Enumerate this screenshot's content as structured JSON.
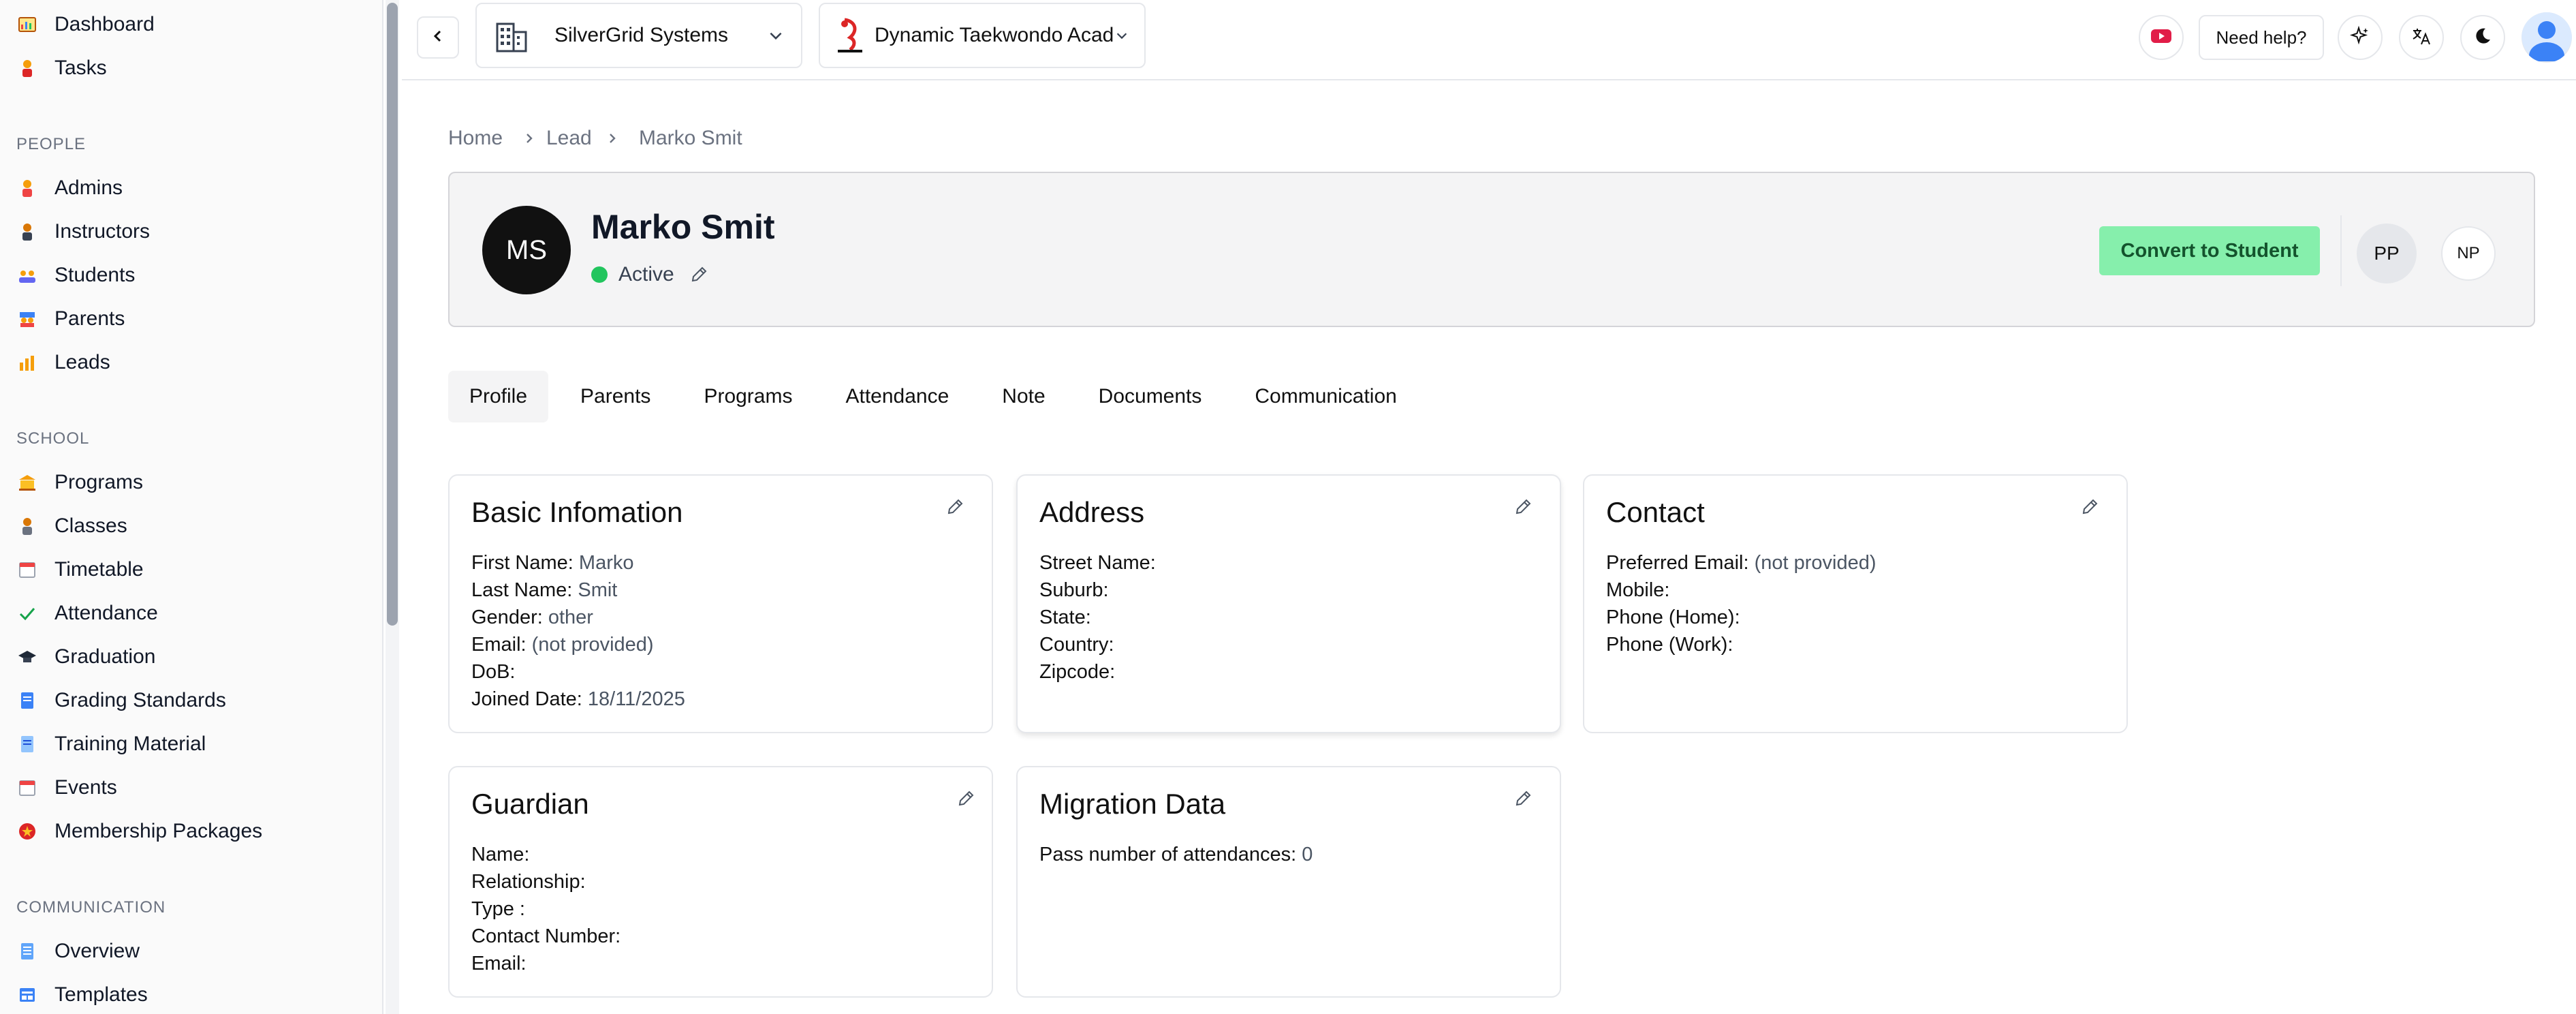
{
  "sidebar": {
    "top_items": [
      {
        "label": "Dashboard",
        "icon": "dashboard-icon"
      },
      {
        "label": "Tasks",
        "icon": "tasks-icon"
      }
    ],
    "sections": [
      {
        "label": "PEOPLE",
        "items": [
          {
            "label": "Admins",
            "icon": "admin-icon"
          },
          {
            "label": "Instructors",
            "icon": "instructor-icon"
          },
          {
            "label": "Students",
            "icon": "students-icon"
          },
          {
            "label": "Parents",
            "icon": "parents-icon"
          },
          {
            "label": "Leads",
            "icon": "leads-icon"
          }
        ]
      },
      {
        "label": "SCHOOL",
        "items": [
          {
            "label": "Programs",
            "icon": "programs-icon"
          },
          {
            "label": "Classes",
            "icon": "classes-icon"
          },
          {
            "label": "Timetable",
            "icon": "calendar-icon"
          },
          {
            "label": "Attendance",
            "icon": "check-icon"
          },
          {
            "label": "Graduation",
            "icon": "graduation-cap-icon"
          },
          {
            "label": "Grading Standards",
            "icon": "document-icon"
          },
          {
            "label": "Training Material",
            "icon": "document-icon"
          },
          {
            "label": "Events",
            "icon": "calendar-icon"
          },
          {
            "label": "Membership Packages",
            "icon": "membership-badge-icon"
          }
        ]
      },
      {
        "label": "COMMUNICATION",
        "items": [
          {
            "label": "Overview",
            "icon": "overview-icon"
          },
          {
            "label": "Templates",
            "icon": "templates-icon"
          }
        ]
      }
    ]
  },
  "header": {
    "org_name": "SilverGrid Systems",
    "school_name": "Dynamic Taekwondo Academy",
    "help_label": "Need help?"
  },
  "breadcrumb": [
    "Home",
    "Lead",
    "Marko Smit"
  ],
  "lead": {
    "initials": "MS",
    "name": "Marko Smit",
    "status": "Active",
    "convert_label": "Convert to Student",
    "avatar_pp": "PP",
    "avatar_np": "NP"
  },
  "tabs": [
    "Profile",
    "Parents",
    "Programs",
    "Attendance",
    "Note",
    "Documents",
    "Communication"
  ],
  "cards": {
    "basic": {
      "title": "Basic Infomation",
      "fields": [
        {
          "k": "First Name:",
          "v": "Marko"
        },
        {
          "k": "Last Name:",
          "v": "Smit"
        },
        {
          "k": "Gender:",
          "v": "other"
        },
        {
          "k": "Email:",
          "v": "(not provided)"
        },
        {
          "k": "DoB:",
          "v": ""
        },
        {
          "k": "Joined Date:",
          "v": "18/11/2025"
        }
      ]
    },
    "address": {
      "title": "Address",
      "fields": [
        {
          "k": "Street Name:",
          "v": ""
        },
        {
          "k": "Suburb:",
          "v": ""
        },
        {
          "k": "State:",
          "v": ""
        },
        {
          "k": "Country:",
          "v": ""
        },
        {
          "k": "Zipcode:",
          "v": ""
        }
      ]
    },
    "contact": {
      "title": "Contact",
      "fields": [
        {
          "k": "Preferred Email:",
          "v": "(not provided)"
        },
        {
          "k": "Mobile:",
          "v": ""
        },
        {
          "k": "Phone (Home):",
          "v": ""
        },
        {
          "k": "Phone (Work):",
          "v": ""
        }
      ]
    },
    "guardian": {
      "title": "Guardian",
      "fields": [
        {
          "k": "Name:",
          "v": ""
        },
        {
          "k": "Relationship:",
          "v": ""
        },
        {
          "k": "Type :",
          "v": ""
        },
        {
          "k": "Contact Number:",
          "v": ""
        },
        {
          "k": "Email:",
          "v": ""
        }
      ]
    },
    "migration": {
      "title": "Migration Data",
      "fields": [
        {
          "k": "Pass number of attendances:",
          "v": "0"
        }
      ]
    }
  },
  "colors": {
    "accent_green": "#86efac",
    "status_active": "#22c55e",
    "youtube_red": "#e11d48"
  }
}
